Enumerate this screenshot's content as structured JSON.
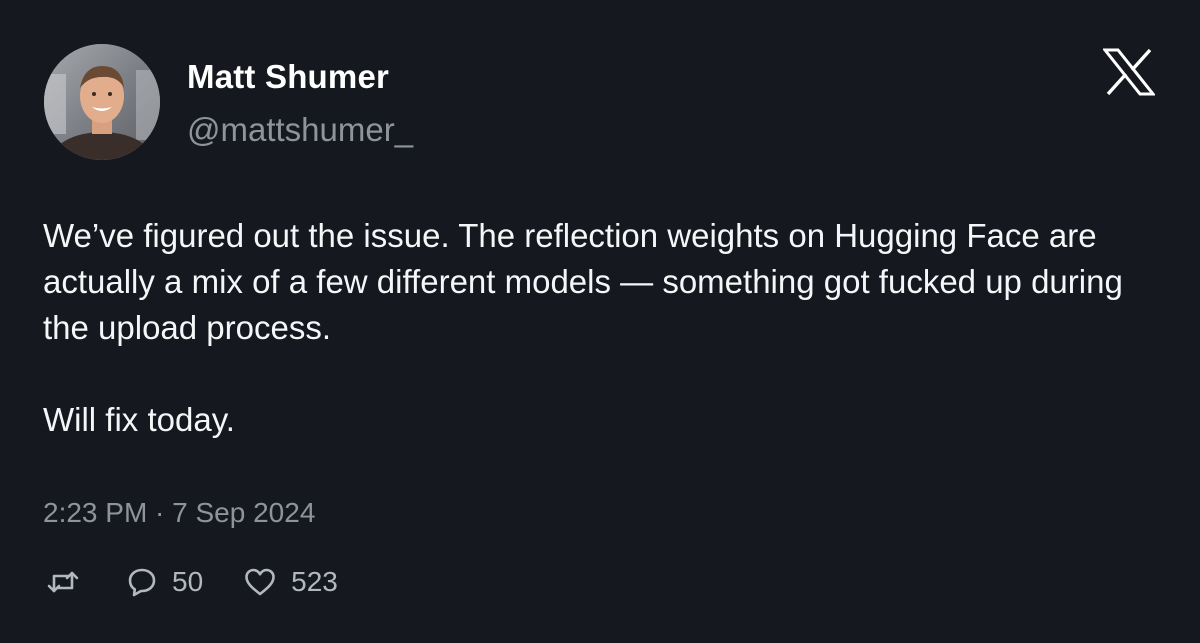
{
  "author": {
    "display_name": "Matt Shumer",
    "handle": "@mattshumer_"
  },
  "brand": {
    "logo_icon": "x-logo-icon"
  },
  "tweet": {
    "paragraphs": [
      "We’ve figured out the issue. The reflection weights on Hugging Face are actually a mix of a few different models — something got fucked up during the upload process.",
      "Will fix today."
    ],
    "timestamp": "2:23 PM · 7 Sep 2024"
  },
  "actions": {
    "retweet_icon": "retweet-icon",
    "reply_icon": "reply-icon",
    "reply_count": "50",
    "like_icon": "heart-icon",
    "like_count": "523"
  },
  "colors": {
    "background": "#15181f",
    "text": "#f5f6f7",
    "muted": "#8e949c"
  }
}
